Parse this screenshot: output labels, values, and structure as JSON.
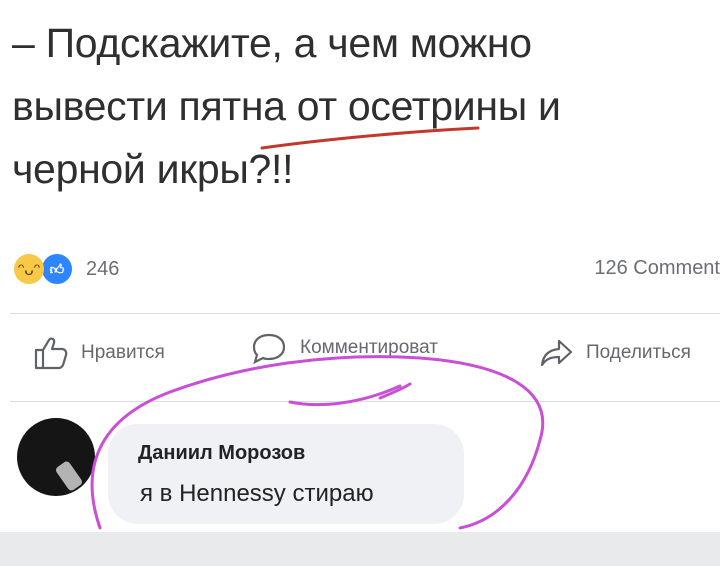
{
  "post": {
    "line1": "– Подскажите, а чем можно",
    "line2": "вывести пятна от осетрины и",
    "line3": "черной икры?!!"
  },
  "reactions": {
    "count": "246",
    "comments": "126 Comment"
  },
  "actions": {
    "like": "Нравится",
    "comment": "Комментироват",
    "share": "Поделиться"
  },
  "comment": {
    "author": "Даниил Морозов",
    "text": "я в Hennessy стираю"
  },
  "colors": {
    "annotation": "#c94fd6",
    "underline": "#c0392b",
    "like_blue": "#2d86ff"
  },
  "icons": {
    "haha": "laughing-face-icon",
    "like": "thumbs-up-icon",
    "comment": "speech-bubble-icon",
    "share": "share-arrow-icon"
  }
}
